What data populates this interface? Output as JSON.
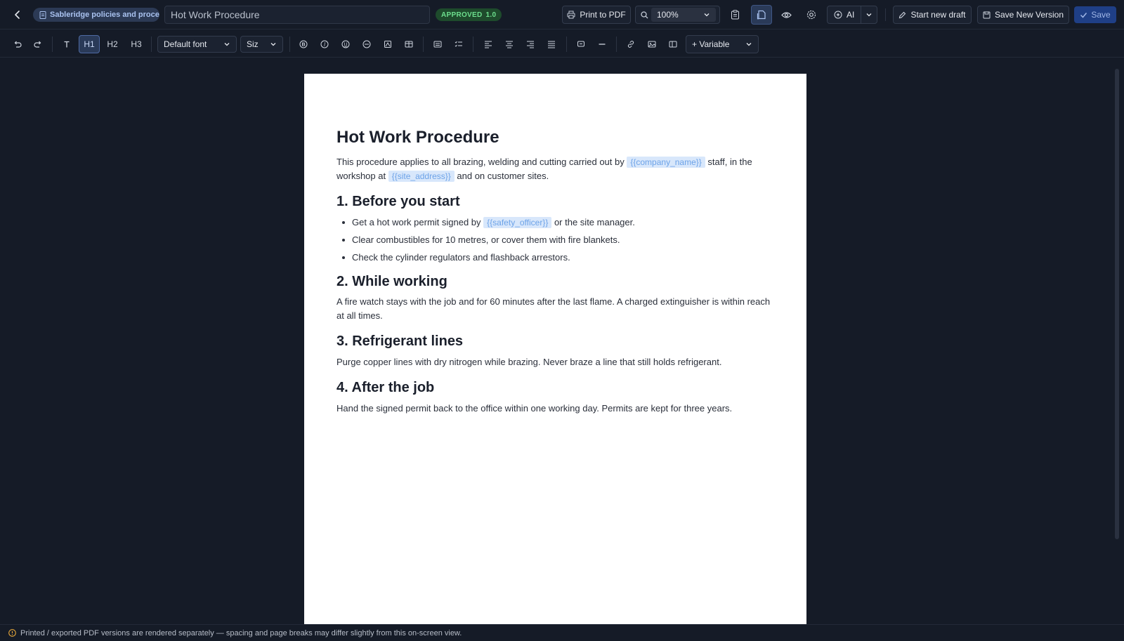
{
  "header": {
    "breadcrumb": "Sableridge policies and proce",
    "document_title": "Hot Work Procedure",
    "status": "APPROVED",
    "version": "1.0",
    "print_label": "Print to PDF",
    "zoom": "100%",
    "ai_label": "AI",
    "new_draft_label": "Start new draft",
    "save_version_label": "Save New Version",
    "save_label": "Save"
  },
  "toolbar": {
    "h1": "H1",
    "h2": "H2",
    "h3": "H3",
    "font": "Default font",
    "size": "Siz",
    "variable": "+ Variable"
  },
  "document": {
    "title": "Hot Work Procedure",
    "intro": {
      "t1": "This procedure applies to all brazing, welding and cutting carried out by ",
      "var1": "{{company_name}}",
      "t2": " staff, in the workshop at ",
      "var2": "{{site_address}}",
      "t3": " and on customer sites."
    },
    "s1": {
      "heading": "1. Before you start",
      "b1_pre": "Get a hot work permit signed by ",
      "b1_var": "{{safety_officer}}",
      "b1_post": " or the site manager.",
      "b2": "Clear combustibles for 10 metres, or cover them with fire blankets.",
      "b3": "Check the cylinder regulators and flashback arrestors."
    },
    "s2": {
      "heading": "2. While working",
      "text": "A fire watch stays with the job and for 60 minutes after the last flame. A charged extinguisher is within reach at all times."
    },
    "s3": {
      "heading": "3. Refrigerant lines",
      "text": "Purge copper lines with dry nitrogen while brazing. Never braze a line that still holds refrigerant."
    },
    "s4": {
      "heading": "4. After the job",
      "text": "Hand the signed permit back to the office within one working day. Permits are kept for three years."
    }
  },
  "footer": {
    "notice": "Printed / exported PDF versions are rendered separately — spacing and page breaks may differ slightly from this on-screen view."
  },
  "colors": {
    "background": "#151b27",
    "accent": "#1f3f86",
    "approved": "#6ddf8e",
    "variable_chip": "#d8e7fb"
  }
}
